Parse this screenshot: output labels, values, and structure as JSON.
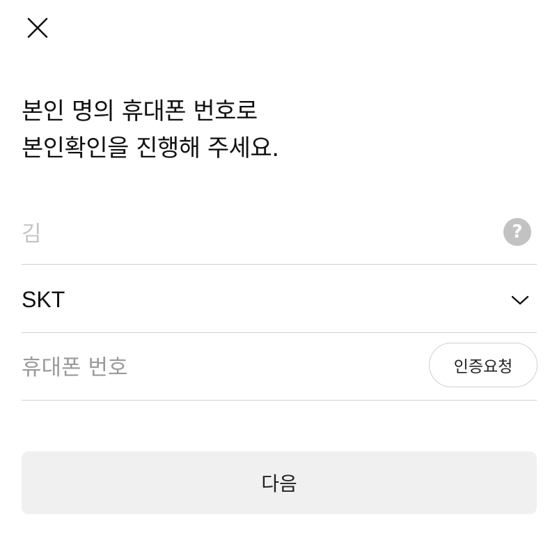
{
  "header": {
    "close_icon": "close-icon"
  },
  "headline": {
    "line1": "본인 명의 휴대폰 번호로",
    "line2": "본인확인을 진행해 주세요."
  },
  "name_field": {
    "value": "김",
    "help_icon": "question-circle-icon",
    "help_glyph": "?"
  },
  "carrier_field": {
    "selected": "SKT",
    "chevron_icon": "chevron-down-icon"
  },
  "phone_field": {
    "placeholder": "휴대폰 번호",
    "value": "",
    "verify_label": "인증요청"
  },
  "next_button": {
    "label": "다음"
  },
  "colors": {
    "divider": "#cfcfcf",
    "button_bg": "#f0f0f0",
    "help_icon_bg": "#c2c2c2",
    "placeholder": "#9a9a9a"
  }
}
